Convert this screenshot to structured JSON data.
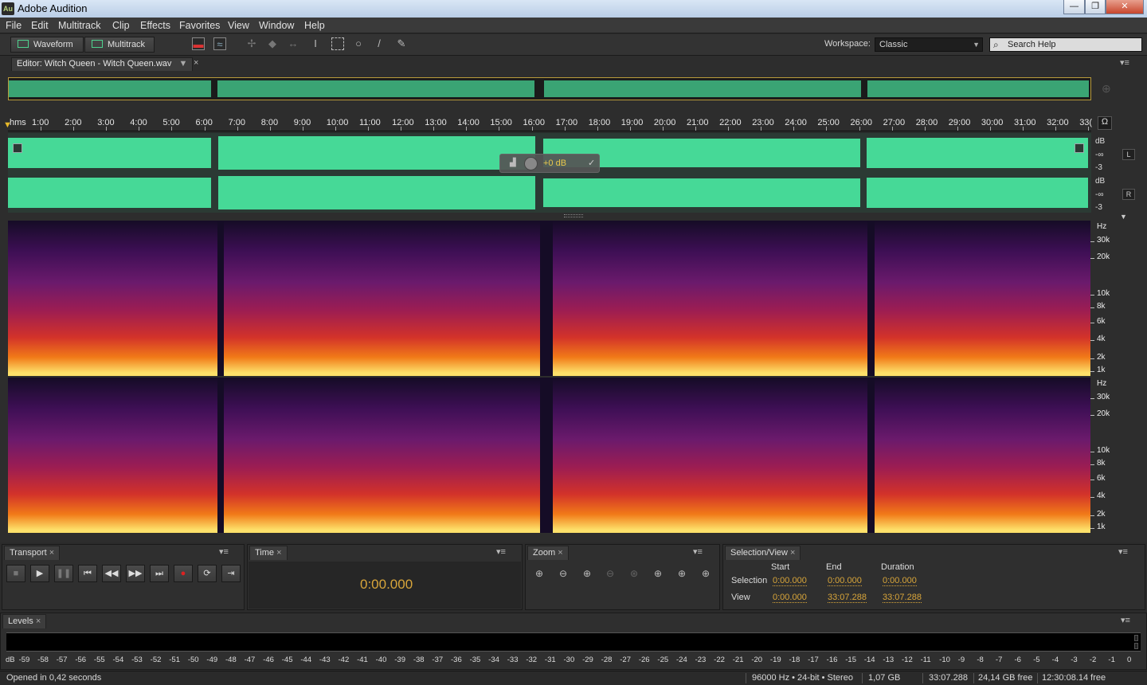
{
  "window": {
    "title": "Adobe Audition",
    "app_icon": "Au",
    "minimize": "—",
    "maximize": "❐",
    "close": "✕"
  },
  "menu": [
    "File",
    "Edit",
    "Multitrack",
    "Clip",
    "Effects",
    "Favorites",
    "View",
    "Window",
    "Help"
  ],
  "toolbar": {
    "waveform": "Waveform",
    "multitrack": "Multitrack",
    "workspace_label": "Workspace:",
    "workspace_value": "Classic",
    "search_placeholder": "Search Help"
  },
  "editor": {
    "tab_label": "Editor: Witch Queen - Witch Queen.wav",
    "tab_close": "×",
    "panel_menu": "▾≡"
  },
  "ruler": {
    "unit": "hms",
    "ticks": [
      "1:00",
      "2:00",
      "3:00",
      "4:00",
      "5:00",
      "6:00",
      "7:00",
      "8:00",
      "9:00",
      "10:00",
      "11:00",
      "12:00",
      "13:00",
      "14:00",
      "15:00",
      "16:00",
      "17:00",
      "18:00",
      "19:00",
      "20:00",
      "21:00",
      "22:00",
      "23:00",
      "24:00",
      "25:00",
      "26:00",
      "27:00",
      "28:00",
      "29:00",
      "30:00",
      "31:00",
      "32:00",
      "33("
    ]
  },
  "waveform": {
    "color": "#46d997",
    "db_unit": "dB",
    "db_inf": "-∞",
    "db_minus3": "-3",
    "left_label": "L",
    "right_label": "R",
    "hud_gain": "+0 dB"
  },
  "spectral": {
    "unit": "Hz",
    "labels": [
      "30k",
      "20k",
      "10k",
      "8k",
      "6k",
      "4k",
      "2k",
      "1k"
    ]
  },
  "transport": {
    "tab": "Transport"
  },
  "time": {
    "tab": "Time",
    "value": "0:00.000"
  },
  "zoom": {
    "tab": "Zoom"
  },
  "selection": {
    "tab": "Selection/View",
    "col_start": "Start",
    "col_end": "End",
    "col_duration": "Duration",
    "row_selection": "Selection",
    "row_view": "View",
    "sel_start": "0:00.000",
    "sel_end": "0:00.000",
    "sel_duration": "0:00.000",
    "view_start": "0:00.000",
    "view_end": "33:07.288",
    "view_duration": "33:07.288"
  },
  "levels": {
    "tab": "Levels",
    "scale": [
      "dB",
      "-59",
      "-58",
      "-57",
      "-56",
      "-55",
      "-54",
      "-53",
      "-52",
      "-51",
      "-50",
      "-49",
      "-48",
      "-47",
      "-46",
      "-45",
      "-44",
      "-43",
      "-42",
      "-41",
      "-40",
      "-39",
      "-38",
      "-37",
      "-36",
      "-35",
      "-34",
      "-33",
      "-32",
      "-31",
      "-30",
      "-29",
      "-28",
      "-27",
      "-26",
      "-25",
      "-24",
      "-23",
      "-22",
      "-21",
      "-20",
      "-19",
      "-18",
      "-17",
      "-16",
      "-15",
      "-14",
      "-13",
      "-12",
      "-11",
      "-10",
      "-9",
      "-8",
      "-7",
      "-6",
      "-5",
      "-4",
      "-3",
      "-2",
      "-1",
      "0"
    ]
  },
  "status": {
    "message": "Opened in 0,42 seconds",
    "format": "96000 Hz • 24-bit • Stereo",
    "size": "1,07 GB",
    "length": "33:07.288",
    "free": "24,14 GB free",
    "time": "12:30:08.14 free"
  }
}
